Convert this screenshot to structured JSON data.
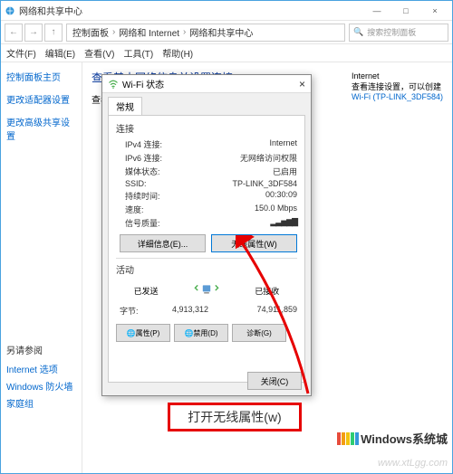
{
  "window": {
    "title": "网络和共享中心",
    "controls": {
      "min": "—",
      "max": "□",
      "close": "×"
    }
  },
  "breadcrumb": {
    "back": "←",
    "fwd": "→",
    "up": "↑",
    "parts": [
      "控制面板",
      "网络和 Internet",
      "网络和共享中心"
    ],
    "search_placeholder": "搜索控制面板",
    "search_icon": "🔍"
  },
  "menu": [
    "文件(F)",
    "编辑(E)",
    "查看(V)",
    "工具(T)",
    "帮助(H)"
  ],
  "sidebar": {
    "items": [
      "控制面板主页",
      "更改适配器设置",
      "更改高级共享设置"
    ]
  },
  "main": {
    "heading": "查看基本网络信息并设置连接",
    "view_active": "查看活动网络",
    "right_col": {
      "internet_label": "Internet",
      "route_label": "查看连接设置，可以创建",
      "wifi_link": "Wi-Fi (TP-LINK_3DF584)"
    }
  },
  "dialog": {
    "title": "Wi-Fi 状态",
    "tab": "常规",
    "sections": {
      "connection_label": "连接",
      "rows": [
        {
          "k": "IPv4 连接:",
          "v": "Internet"
        },
        {
          "k": "IPv6 连接:",
          "v": "无网络访问权限"
        },
        {
          "k": "媒体状态:",
          "v": "已启用"
        },
        {
          "k": "SSID:",
          "v": "TP-LINK_3DF584"
        },
        {
          "k": "持续时间:",
          "v": "00:30:09"
        },
        {
          "k": "速度:",
          "v": "150.0 Mbps"
        }
      ],
      "signal_label": "信号质量:",
      "signal_bars": "▂▃▅▆▇",
      "detail_btn": "详细信息(E)...",
      "wireless_btn": "无线属性(W)",
      "activity_label": "活动",
      "sent_label": "已发送",
      "recv_label": "已接收",
      "bytes_label": "字节:",
      "sent_val": "4,913,312",
      "recv_val": "74,911,859",
      "props_btn": "属性(P)",
      "disable_btn": "禁用(D)",
      "diag_btn": "诊断(G)",
      "close_btn": "关闭(C)"
    }
  },
  "callout": "打开无线属性(w)",
  "seealso": {
    "title": "另请参阅",
    "links": [
      "Internet 选项",
      "Windows 防火墙",
      "家庭组"
    ]
  },
  "watermark": {
    "url": "www.xtLgg.com",
    "logo_text": "Windows系统城",
    "bar_colors": [
      "#e74c3c",
      "#f39c12",
      "#f1c40f",
      "#2ecc71",
      "#3498db"
    ]
  }
}
